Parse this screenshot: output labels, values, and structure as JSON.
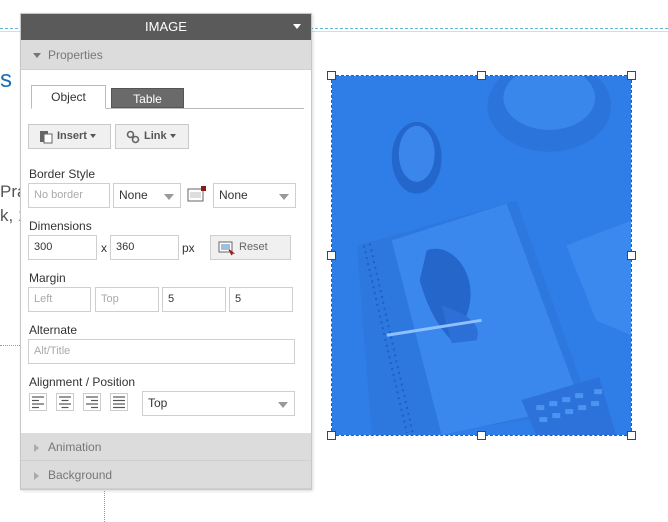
{
  "panel": {
    "title": "IMAGE",
    "properties_label": "Properties",
    "tabs": [
      {
        "label": "Object",
        "active": true
      },
      {
        "label": "Table",
        "active": false
      }
    ],
    "toolbar": {
      "insert_label": "Insert",
      "link_label": "Link"
    },
    "border_style": {
      "label": "Border Style",
      "width_placeholder": "No border",
      "style_value": "None",
      "color_value": "None"
    },
    "dimensions": {
      "label": "Dimensions",
      "width": "300",
      "separator": "x",
      "height": "360",
      "unit": "px",
      "reset_label": "Reset"
    },
    "margin": {
      "label": "Margin",
      "left_placeholder": "Left",
      "top_placeholder": "Top",
      "right_value": "5",
      "bottom_value": "5"
    },
    "alternate": {
      "label": "Alternate",
      "placeholder": "Alt/Title"
    },
    "alignment": {
      "label": "Alignment / Position",
      "position_value": "Top"
    },
    "animation_label": "Animation",
    "background_label": "Background"
  },
  "background": {
    "heading_fragment": "s",
    "line1_fragment": "Pra",
    "line2_fragment": "k, 1"
  },
  "colors": {
    "header": "#5a5a5a",
    "image_tint": "#2f7de6",
    "heading": "#1b6fb8"
  }
}
